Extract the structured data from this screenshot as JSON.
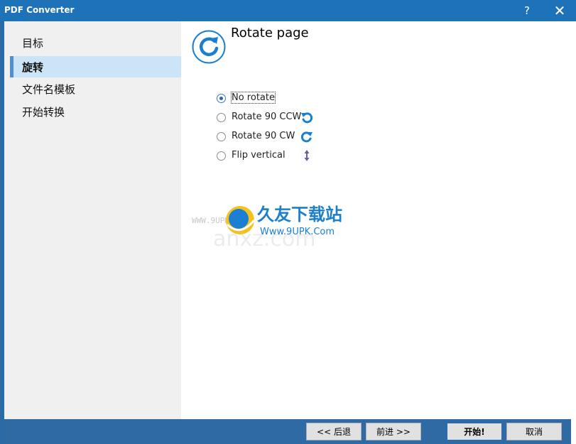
{
  "window": {
    "title": "PDF Converter",
    "help": "?",
    "close": "✕"
  },
  "sidebar": {
    "items": [
      {
        "label": "目标"
      },
      {
        "label": "旋转"
      },
      {
        "label": "文件名模板"
      },
      {
        "label": "开始转换"
      }
    ],
    "selected_index": 1
  },
  "main": {
    "title": "Rotate page",
    "options": [
      {
        "label": "No rotate",
        "checked": true
      },
      {
        "label": "Rotate 90 CCW",
        "checked": false
      },
      {
        "label": "Rotate 90 CW",
        "checked": false
      },
      {
        "label": "Flip vertical",
        "checked": false
      }
    ]
  },
  "footer": {
    "back": "<< 后退",
    "next": "前进 >>",
    "start": "开始!",
    "cancel": "取消"
  },
  "watermark": {
    "brand": "久友下载站",
    "url": "WWW.9UPK.COM",
    "url2": "Www.9UPK.Com",
    "faint": "anxz.com"
  },
  "colors": {
    "titlebar": "#1e73b8",
    "footer": "#2f6aa5",
    "accent": "#1a7fd0",
    "selection": "#cce4f7"
  }
}
